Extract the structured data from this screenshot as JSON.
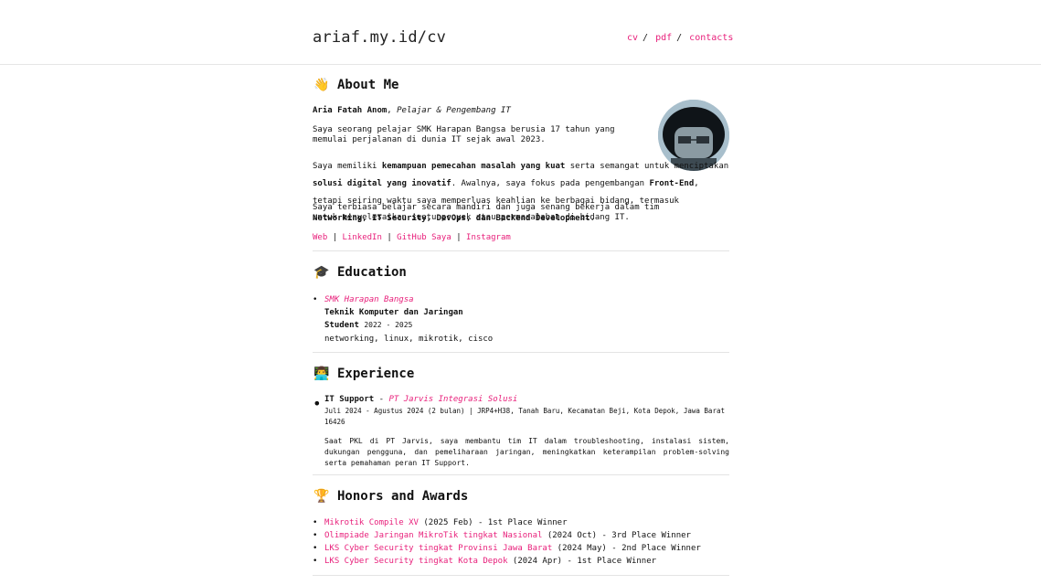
{
  "header": {
    "title": "ariaf.my.id/cv",
    "nav": [
      "cv",
      "pdf",
      "contacts"
    ],
    "sep": "/"
  },
  "about": {
    "emoji": "👋",
    "heading": "About Me",
    "name": "Aria Fatah Anom",
    "comma": ",",
    "role": "Pelajar & Pengembang IT",
    "p1": "Saya seorang pelajar SMK Harapan Bangsa berusia 17 tahun yang memulai perjalanan di dunia IT sejak awal 2023.",
    "p2a": "Saya memiliki ",
    "p2b": "kemampuan pemecahan masalah yang kuat",
    "p2c": " serta semangat untuk menciptakan ",
    "p2d": "solusi digital yang inovatif",
    "p2e": ". Awalnya, saya fokus pada pengembangan ",
    "p2f": "Front-End",
    "p2g": ", tetapi seiring waktu saya memperluas keahlian ke berbagai bidang, termasuk ",
    "p2h": "Networking, IT Security, DevOps, dan Backend Development",
    "p2i": ".",
    "p3": "Saya terbiasa belajar secara mandiri dan juga senang bekerja dalam tim untuk menyelesaikan suatu proyek atau permasalahan di bidang IT.",
    "links": [
      "Web",
      "LinkedIn",
      "GitHub Saya",
      "Instagram"
    ],
    "link_sep": "|"
  },
  "education": {
    "emoji": "🎓",
    "heading": "Education",
    "school": "SMK Harapan Bangsa",
    "major": "Teknik Komputer dan Jaringan",
    "status": "Student",
    "years": "2022 - 2025",
    "tags": "networking, linux, mikrotik, cisco"
  },
  "experience": {
    "emoji": "👨‍💻",
    "heading": "Experience",
    "title": "IT Support",
    "dash": " - ",
    "company": "PT Jarvis Integrasi Solusi",
    "meta": "Juli 2024 - Agustus 2024 (2 bulan) | JRP4+H38, Tanah Baru, Kecamatan Beji, Kota Depok, Jawa Barat 16426",
    "desc": "Saat PKL di PT Jarvis, saya membantu tim IT dalam troubleshooting, instalasi sistem, dukungan pengguna, dan pemeliharaan jaringan, meningkatkan keterampilan problem-solving serta pemahaman peran IT Support."
  },
  "honors": {
    "emoji": "🏆",
    "heading": "Honors and Awards",
    "items": [
      {
        "link": "Mikrotik Compile XV",
        "rest": " (2025 Feb) - 1st Place Winner"
      },
      {
        "link": "Olimpiade Jaringan MikroTik tingkat Nasional",
        "rest": " (2024 Oct) - 3rd Place Winner"
      },
      {
        "link": "LKS Cyber Security tingkat Provinsi Jawa Barat",
        "rest": " (2024 May) - 2nd Place Winner"
      },
      {
        "link": "LKS Cyber Security tingkat Kota Depok",
        "rest": " (2024 Apr) - 1st Place Winner"
      }
    ]
  }
}
